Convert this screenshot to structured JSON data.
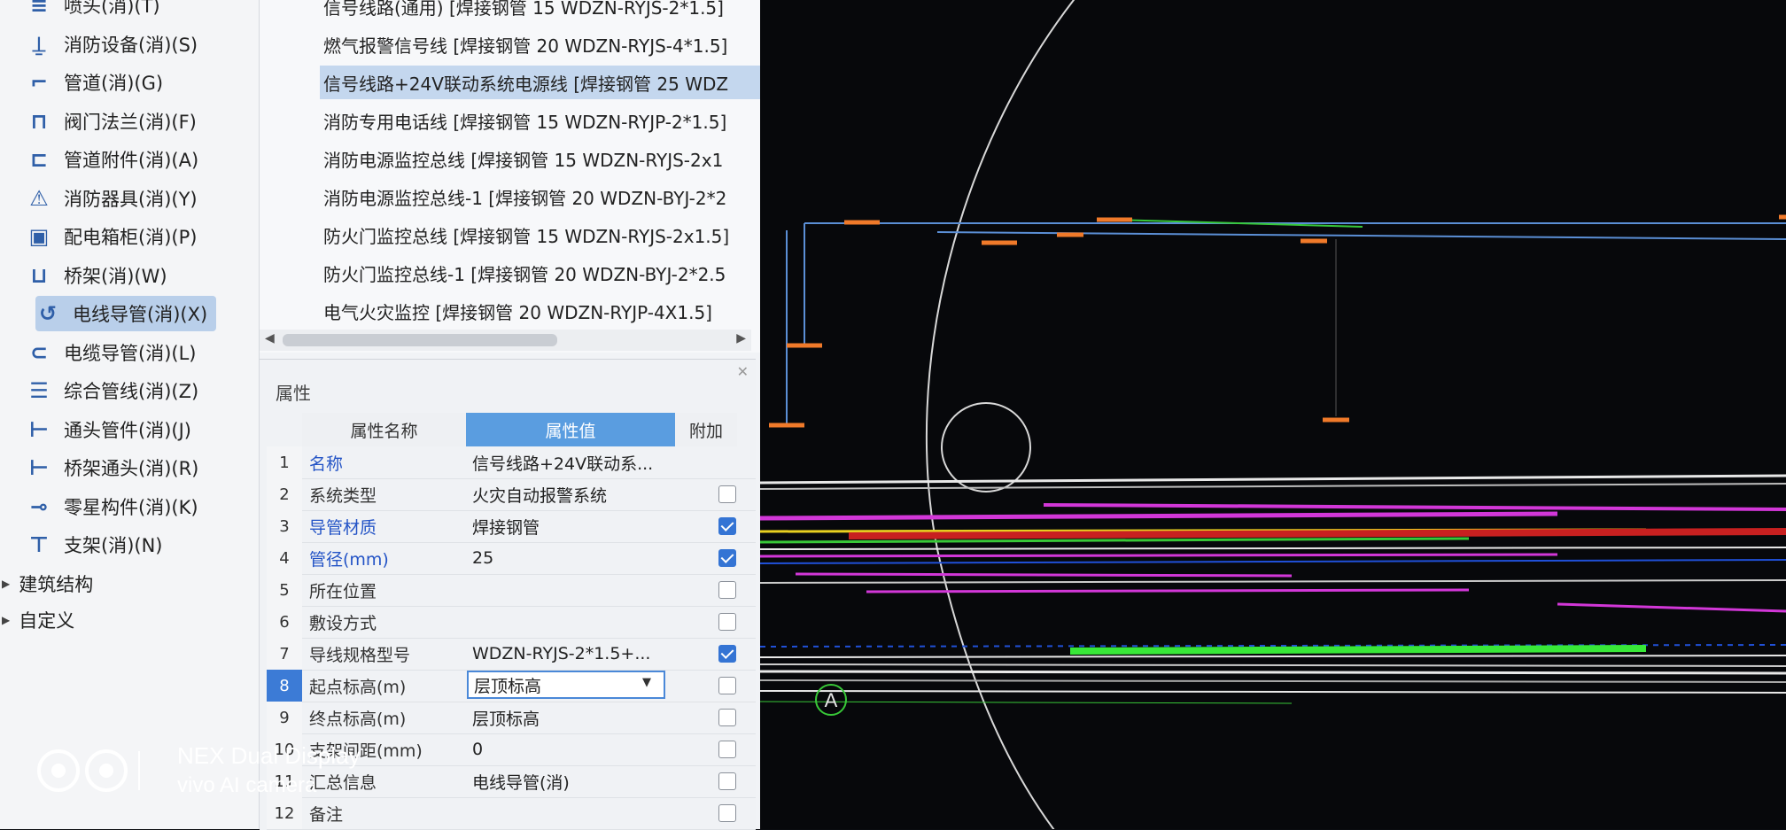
{
  "tree": {
    "items": [
      {
        "label": "喷头(消)(T)",
        "icon": "sprinkler-icon",
        "glyph": "≡"
      },
      {
        "label": "消防设备(消)(S)",
        "icon": "fire-equipment-icon",
        "glyph": "⍊"
      },
      {
        "label": "管道(消)(G)",
        "icon": "pipe-icon",
        "glyph": "⌐"
      },
      {
        "label": "阀门法兰(消)(F)",
        "icon": "valve-icon",
        "glyph": "⊓"
      },
      {
        "label": "管道附件(消)(A)",
        "icon": "pipe-accessory-icon",
        "glyph": "⊏"
      },
      {
        "label": "消防器具(消)(Y)",
        "icon": "alarm-icon",
        "glyph": "⚠"
      },
      {
        "label": "配电箱柜(消)(P)",
        "icon": "distribution-box-icon",
        "glyph": "▣"
      },
      {
        "label": "桥架(消)(W)",
        "icon": "cable-tray-icon",
        "glyph": "⊔"
      },
      {
        "label": "电线导管(消)(X)",
        "icon": "wire-conduit-icon",
        "glyph": "↺"
      },
      {
        "label": "电缆导管(消)(L)",
        "icon": "cable-conduit-icon",
        "glyph": "⊂"
      },
      {
        "label": "综合管线(消)(Z)",
        "icon": "combined-pipeline-icon",
        "glyph": "☰"
      },
      {
        "label": "通头管件(消)(J)",
        "icon": "fitting-icon",
        "glyph": "⊢"
      },
      {
        "label": "桥架通头(消)(R)",
        "icon": "tray-fitting-icon",
        "glyph": "⊢"
      },
      {
        "label": "零星构件(消)(K)",
        "icon": "misc-component-icon",
        "glyph": "⊸"
      },
      {
        "label": "支架(消)(N)",
        "icon": "support-icon",
        "glyph": "⊤"
      }
    ],
    "selected_index": 8,
    "groups": [
      {
        "label": "建筑结构"
      },
      {
        "label": "自定义"
      }
    ]
  },
  "component_list": {
    "rows": [
      "信号线路(通用) [焊接钢管 15 WDZN-RYJS-2*1.5]",
      "燃气报警信号线 [焊接钢管 20 WDZN-RYJS-4*1.5]",
      "信号线路+24V联动系统电源线 [焊接钢管 25 WDZ",
      "消防专用电话线 [焊接钢管 15 WDZN-RYJP-2*1.5]",
      "消防电源监控总线 [焊接钢管 15 WDZN-RYJS-2x1",
      "消防电源监控总线-1 [焊接钢管 20 WDZN-BYJ-2*2",
      "防火门监控总线 [焊接钢管 15 WDZN-RYJS-2x1.5]",
      "防火门监控总线-1 [焊接钢管 20 WDZN-BYJ-2*2.5",
      "电气火灾监控 [焊接钢管 20 WDZN-RYJP-4X1.5]"
    ],
    "selected_index": 2
  },
  "properties": {
    "title": "属性",
    "headers": {
      "name": "属性名称",
      "value": "属性值",
      "extra": "附加"
    },
    "rows": [
      {
        "num": "1",
        "name": "名称",
        "value": "信号线路+24V联动系...",
        "blue": true,
        "check": null
      },
      {
        "num": "2",
        "name": "系统类型",
        "value": "火灾自动报警系统",
        "blue": false,
        "check": false
      },
      {
        "num": "3",
        "name": "导管材质",
        "value": "焊接钢管",
        "blue": true,
        "check": true
      },
      {
        "num": "4",
        "name": "管径(mm)",
        "value": "25",
        "blue": true,
        "check": true
      },
      {
        "num": "5",
        "name": "所在位置",
        "value": "",
        "blue": false,
        "check": false
      },
      {
        "num": "6",
        "name": "敷设方式",
        "value": "",
        "blue": false,
        "check": false
      },
      {
        "num": "7",
        "name": "导线规格型号",
        "value": "WDZN-RYJS-2*1.5+...",
        "blue": false,
        "check": true
      },
      {
        "num": "8",
        "name": "起点标高(m)",
        "value": "层顶标高",
        "blue": false,
        "check": false,
        "editing": true
      },
      {
        "num": "9",
        "name": "终点标高(m)",
        "value": "层顶标高",
        "blue": false,
        "check": false
      },
      {
        "num": "10",
        "name": "支架间距(mm)",
        "value": "0",
        "blue": false,
        "check": false
      },
      {
        "num": "11",
        "name": "汇总信息",
        "value": "电线导管(消)",
        "blue": false,
        "check": false
      },
      {
        "num": "12",
        "name": "备注",
        "value": "",
        "blue": false,
        "check": false
      }
    ]
  },
  "cad": {
    "axis_label": "A"
  },
  "watermark": {
    "line1": "NEX Dual Display",
    "line2": "vivo AI camera"
  }
}
